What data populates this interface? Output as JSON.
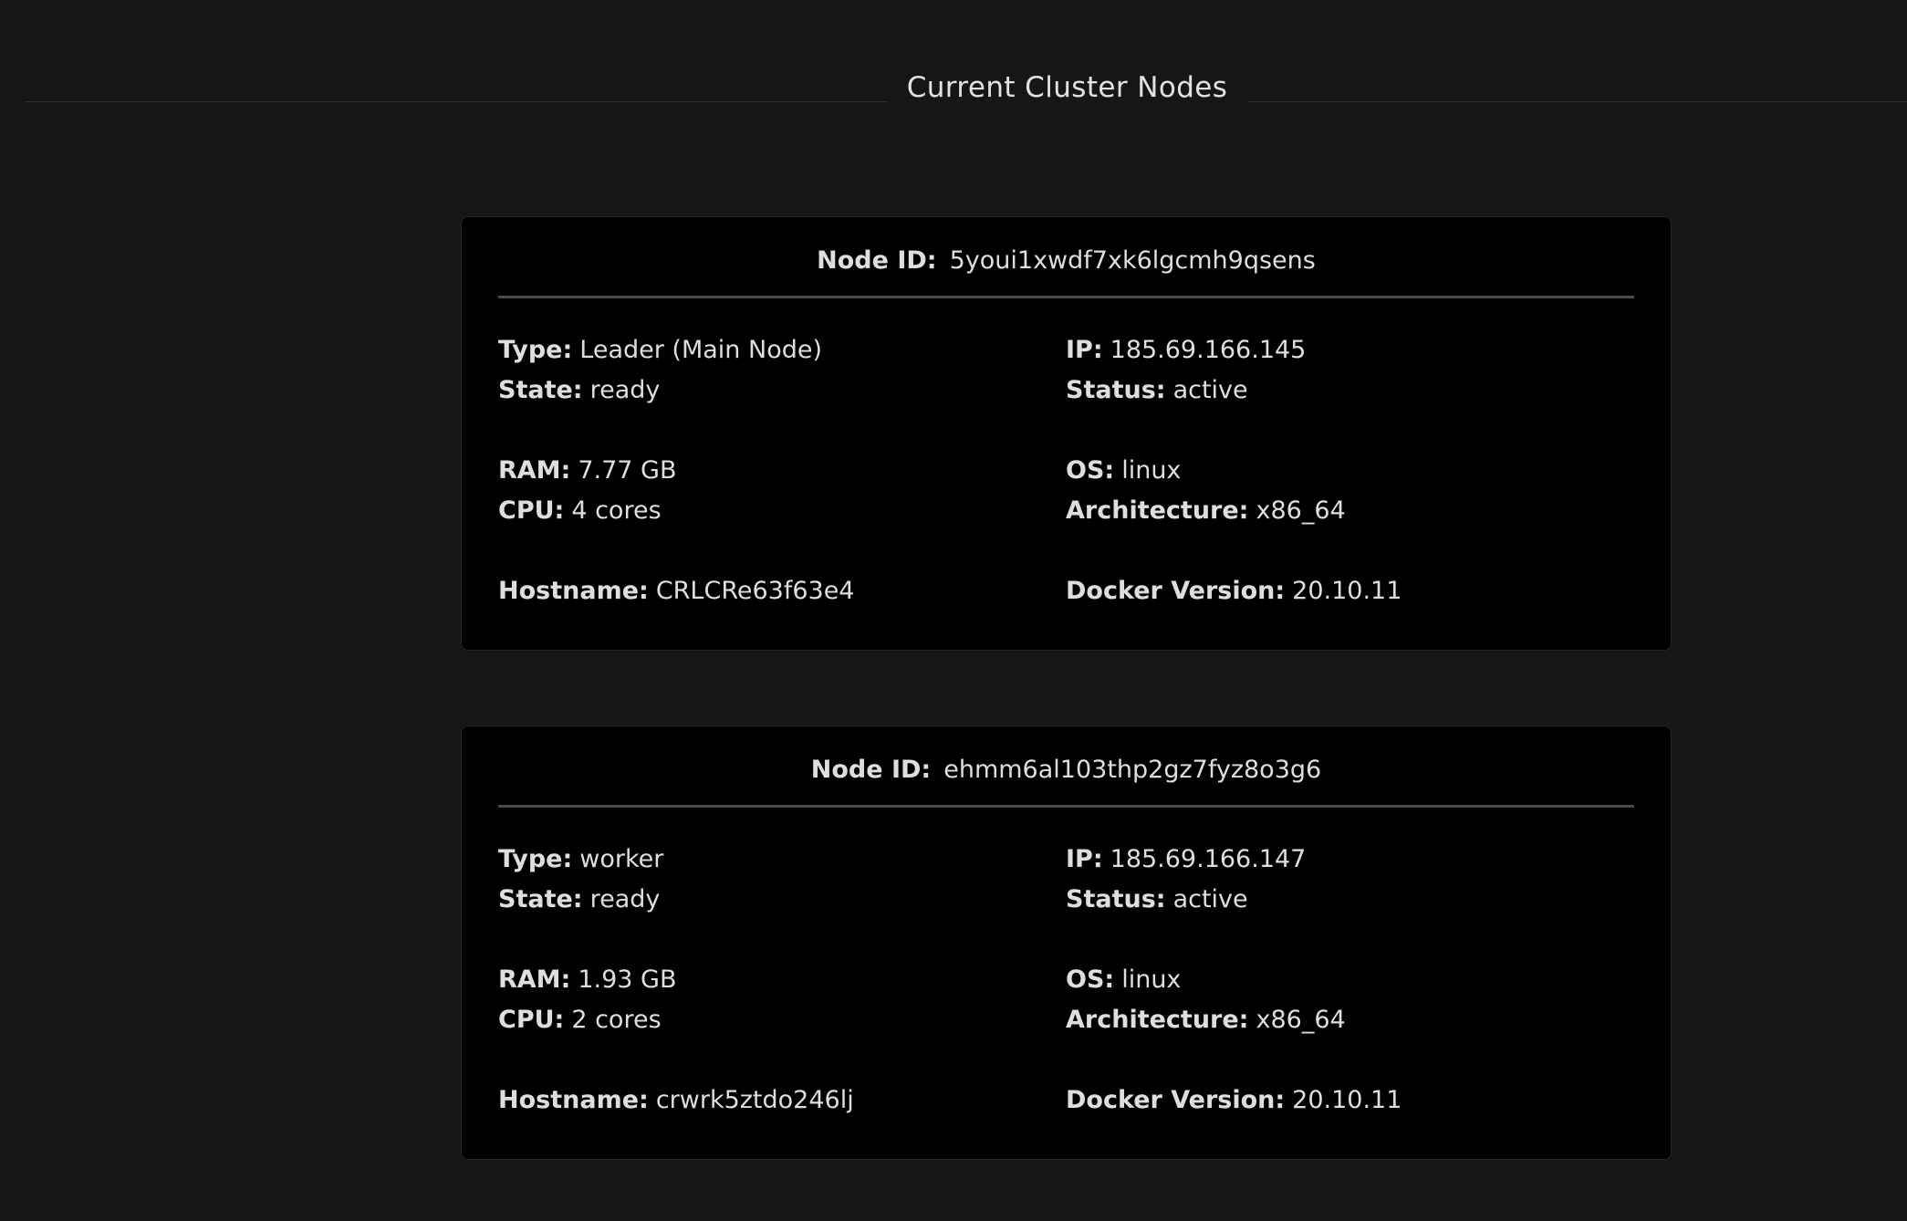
{
  "section_title": "Current Cluster Nodes",
  "labels": {
    "node_id": "Node ID:",
    "type": "Type:",
    "state": "State:",
    "ram": "RAM:",
    "cpu": "CPU:",
    "hostname": "Hostname:",
    "ip": "IP:",
    "status": "Status:",
    "os": "OS:",
    "architecture": "Architecture:",
    "docker_version": "Docker Version:"
  },
  "nodes": [
    {
      "node_id": "5youi1xwdf7xk6lgcmh9qsens",
      "type": "Leader (Main Node)",
      "state": "ready",
      "ram": "7.77 GB",
      "cpu": "4 cores",
      "hostname": "CRLCRe63f63e4",
      "ip": "185.69.166.145",
      "status": "active",
      "os": "linux",
      "architecture": "x86_64",
      "docker_version": "20.10.11"
    },
    {
      "node_id": "ehmm6al103thp2gz7fyz8o3g6",
      "type": "worker",
      "state": "ready",
      "ram": "1.93 GB",
      "cpu": "2 cores",
      "hostname": "crwrk5ztdo246lj",
      "ip": "185.69.166.147",
      "status": "active",
      "os": "linux",
      "architecture": "x86_64",
      "docker_version": "20.10.11"
    }
  ]
}
